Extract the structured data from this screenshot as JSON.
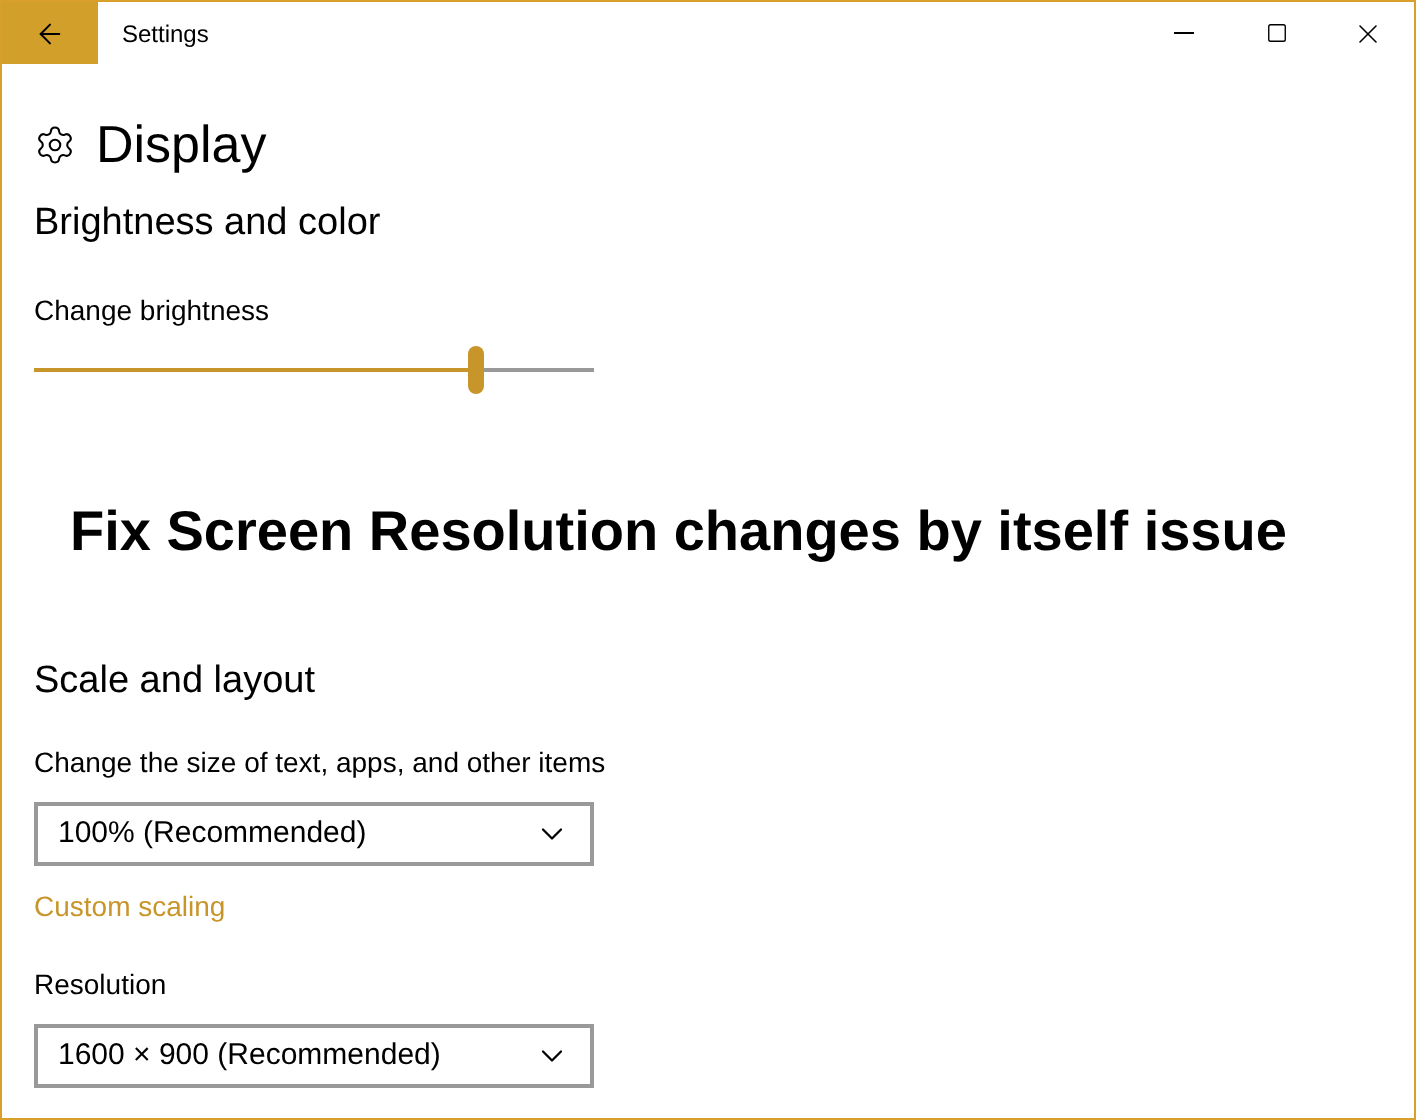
{
  "window": {
    "title": "Settings"
  },
  "page": {
    "title": "Display"
  },
  "brightness_section": {
    "heading": "Brightness and color",
    "slider": {
      "label": "Change brightness",
      "level": 0.79
    }
  },
  "caption": "Fix Screen Resolution changes by itself issue",
  "scale_section": {
    "heading": "Scale and layout",
    "size_label": "Change the size of text, apps, and other items",
    "size_value": "100% (Recommended)",
    "link": "Custom scaling",
    "resolution_label": "Resolution",
    "resolution_value": "1600 × 900 (Recommended)"
  }
}
